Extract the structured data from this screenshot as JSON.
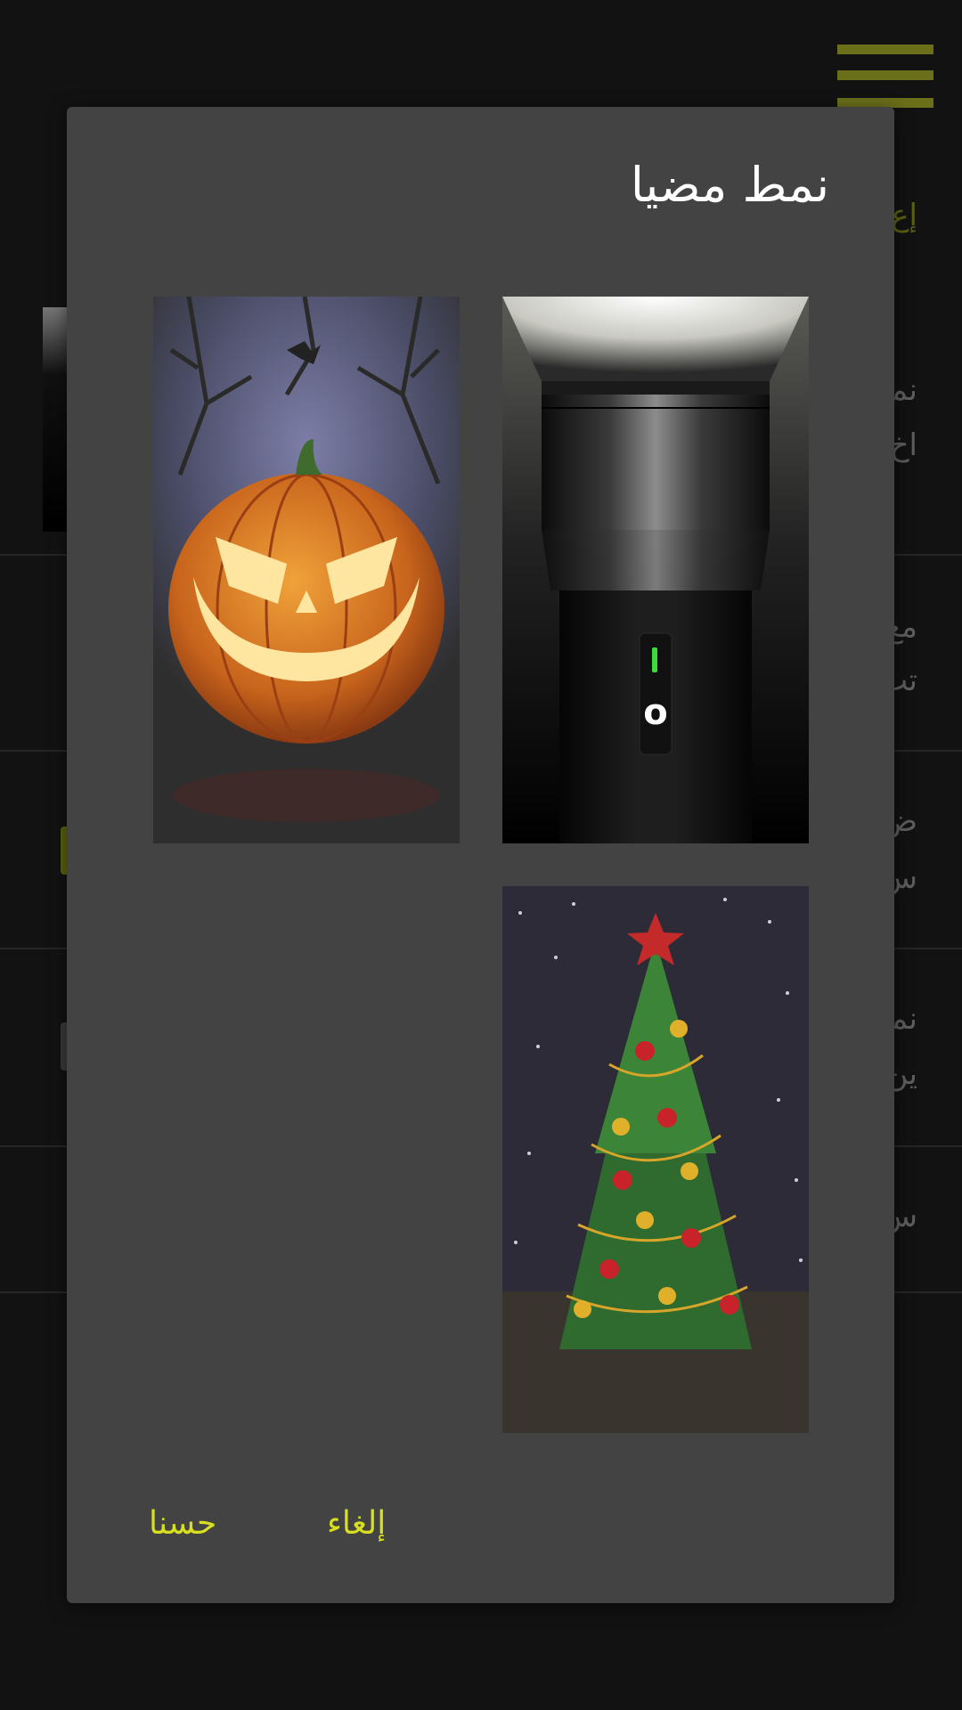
{
  "background_screen": {
    "accent_label": "إع",
    "items": [
      {
        "title": "نم",
        "subtitle": "اخ"
      },
      {
        "title": "مع",
        "subtitle": "تب"
      },
      {
        "title": "ض",
        "subtitle": "س"
      },
      {
        "title": "نم",
        "subtitle": "ين"
      },
      {
        "title": "س"
      }
    ]
  },
  "dialog": {
    "title": "نمط مضيا",
    "styles": [
      {
        "name": "flashlight",
        "icon": "flashlight-image",
        "switch_label": "o",
        "selected": true
      },
      {
        "name": "halloween",
        "icon": "pumpkin-image"
      },
      {
        "name": "christmas",
        "icon": "christmas-tree-image"
      }
    ],
    "buttons": {
      "cancel": "إلغاء",
      "ok": "حسنا"
    }
  },
  "colors": {
    "accent": "#d8df20",
    "dialog_bg": "#434343",
    "screen_bg": "#121212",
    "switch_indicator": "#3ddc3d"
  }
}
